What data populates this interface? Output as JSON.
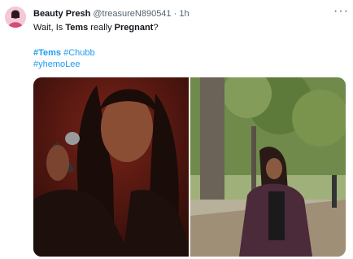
{
  "author": {
    "name": "Beauty Presh",
    "handle": "@treasureN890541",
    "separator": "·",
    "time": "1h"
  },
  "tweet": {
    "t1": "Wait, Is ",
    "t2": "Tems",
    "t3": " really ",
    "t4": "Pregnant",
    "t5": "?",
    "hashtags_line1": [
      "#Tems",
      "#Chubb"
    ],
    "hashtags_line2": [
      "#yhemoLee"
    ]
  },
  "menu": {
    "more_glyph": "···"
  },
  "icons": {
    "avatar": "user-avatar",
    "more": "more-options-icon"
  },
  "colors": {
    "link": "#1d9bf0",
    "secondary": "#536471",
    "primary": "#0f1419"
  }
}
